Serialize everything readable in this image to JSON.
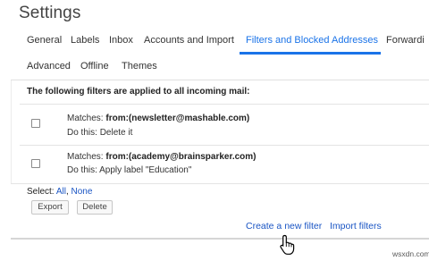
{
  "page": {
    "title": "Settings"
  },
  "tabs": [
    {
      "label": "General"
    },
    {
      "label": "Labels"
    },
    {
      "label": "Inbox"
    },
    {
      "label": "Accounts and Import"
    },
    {
      "label": "Filters and Blocked Addresses",
      "active": true
    },
    {
      "label": "Forwardi"
    },
    {
      "label": "Advanced"
    },
    {
      "label": "Offline"
    },
    {
      "label": "Themes"
    }
  ],
  "filters": {
    "heading": "The following filters are applied to all incoming mail:",
    "items": [
      {
        "matches_label": "Matches: ",
        "matches_value": "from:(newsletter@mashable.com)",
        "action_label": "Do this: ",
        "action_value": "Delete it"
      },
      {
        "matches_label": "Matches: ",
        "matches_value": "from:(academy@brainsparker.com)",
        "action_label": "Do this: ",
        "action_value": "Apply label \"Education\""
      }
    ]
  },
  "selection": {
    "label": "Select: ",
    "all": "All",
    "separator": ", ",
    "none": "None"
  },
  "buttons": {
    "export": "Export",
    "delete": "Delete"
  },
  "links": {
    "create_filter": "Create a new filter",
    "import_filters": "Import filters"
  },
  "watermark": "wsxdn.com",
  "colors": {
    "accent": "#1a73e8",
    "link": "#1a55c4"
  }
}
